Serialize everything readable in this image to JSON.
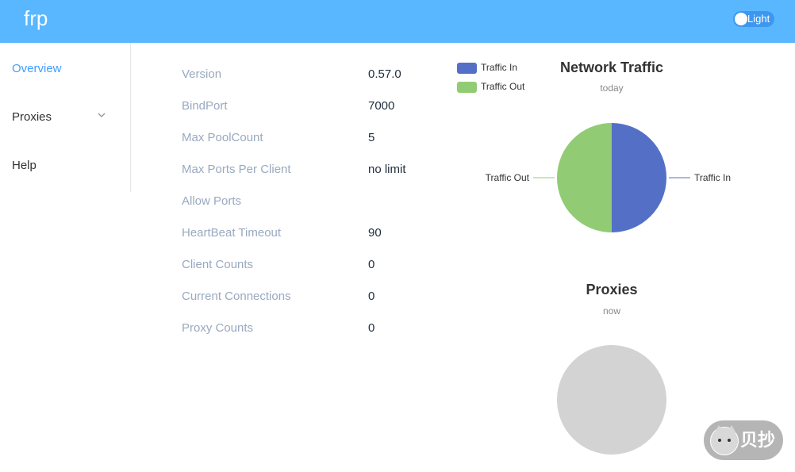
{
  "header": {
    "brand": "frp",
    "theme_label": "Light"
  },
  "sidebar": {
    "items": [
      {
        "label": "Overview",
        "active": true
      },
      {
        "label": "Proxies",
        "expandable": true
      },
      {
        "label": "Help"
      }
    ]
  },
  "server_info": [
    {
      "label": "Version",
      "value": "0.57.0"
    },
    {
      "label": "BindPort",
      "value": "7000"
    },
    {
      "label": "Max PoolCount",
      "value": "5"
    },
    {
      "label": "Max Ports Per Client",
      "value": "no limit"
    },
    {
      "label": "Allow Ports",
      "value": ""
    },
    {
      "label": "HeartBeat Timeout",
      "value": "90"
    },
    {
      "label": "Client Counts",
      "value": "0"
    },
    {
      "label": "Current Connections",
      "value": "0"
    },
    {
      "label": "Proxy Counts",
      "value": "0"
    }
  ],
  "chart_data": [
    {
      "type": "pie",
      "title": "Network Traffic",
      "subtitle": "today",
      "legend": [
        "Traffic In",
        "Traffic Out"
      ],
      "legend_position": "top-left",
      "categories": [
        "Traffic In",
        "Traffic Out"
      ],
      "values": [
        50,
        50
      ],
      "colors": [
        "#5470c6",
        "#91cc75"
      ]
    },
    {
      "type": "pie",
      "title": "Proxies",
      "subtitle": "now",
      "categories": [],
      "values": [],
      "empty_color": "#d3d3d3"
    }
  ],
  "colors": {
    "header_bg": "#58b7ff",
    "active_menu": "#409eff",
    "label": "#99a9bf"
  },
  "badge": {
    "text": "贝抄",
    "icon": "husky-icon"
  }
}
